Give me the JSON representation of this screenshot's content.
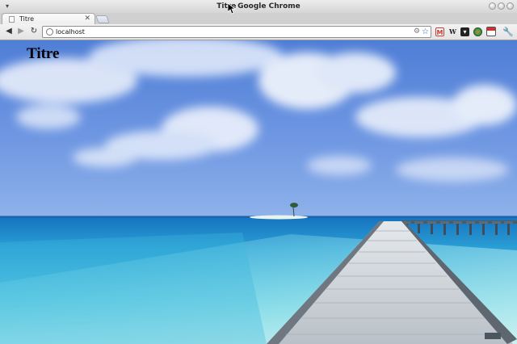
{
  "window": {
    "title": "Titre - Google Chrome",
    "title_display": "Titre Google Chrome"
  },
  "tabs": [
    {
      "label": "Titre",
      "close": "✕",
      "active": true
    }
  ],
  "toolbar": {
    "back_icon": "arrow-left-icon",
    "forward_icon": "arrow-right-icon",
    "reload_icon": "reload-icon",
    "back_glyph": "◀",
    "forward_glyph": "▶",
    "reload_glyph": "↻",
    "omnibox": {
      "url": "localhost"
    },
    "extensions": [
      {
        "name": "gmail-checker",
        "glyph": "M"
      },
      {
        "name": "wikipedia",
        "glyph": "W"
      },
      {
        "name": "pocket",
        "glyph": "▾"
      },
      {
        "name": "color-picker",
        "glyph": ""
      },
      {
        "name": "calendar",
        "glyph": ""
      }
    ],
    "menu_glyph": "🔧"
  },
  "page": {
    "heading": "Titre"
  },
  "colors": {
    "sky_top": "#5b86d9",
    "sky_bottom": "#7ea3e4",
    "sea_deep": "#1b7fc4",
    "sea_shallow": "#7fd6e6",
    "pier": "#c8cdd3"
  }
}
